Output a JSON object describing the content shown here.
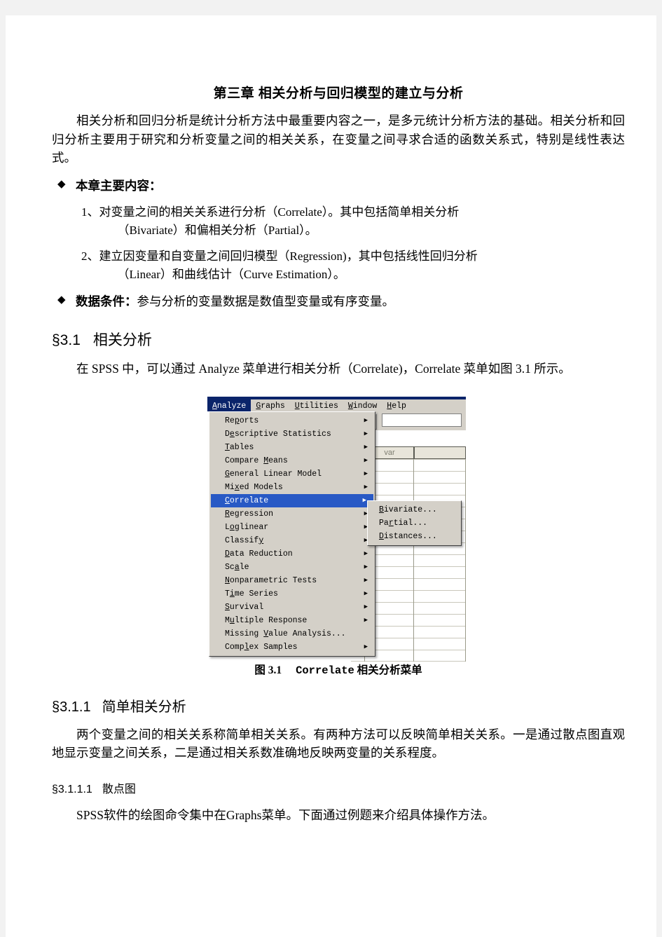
{
  "document": {
    "title": "第三章  相关分析与回归模型的建立与分析",
    "intro_paragraph": "相关分析和回归分析是统计分析方法中最重要内容之一，是多元统计分析方法的基础。相关分析和回归分析主要用于研究和分析变量之间的相关关系，在变量之间寻求合适的函数关系式，特别是线性表达式。",
    "bullets": {
      "marker": "◆",
      "main_content_label": "本章主要内容：",
      "items": [
        {
          "number": "1、",
          "line1": "对变量之间的相关关系进行分析（Correlate）。其中包括简单相关分析",
          "line2": "（Bivariate）和偏相关分析（Partial）。"
        },
        {
          "number": "2、",
          "line1": "建立因变量和自变量之间回归模型（Regression)，其中包括线性回归分析",
          "line2": "（Linear）和曲线估计（Curve Estimation）。"
        }
      ],
      "data_condition_label": "数据条件：",
      "data_condition_text": "参与分析的变量数据是数值型变量或有序变量。"
    },
    "sections": [
      {
        "number": "§3.1",
        "title": "相关分析",
        "paragraph": "在 SPSS 中，可以通过 Analyze 菜单进行相关分析（Correlate)，Correlate 菜单如图 3.1 所示。"
      },
      {
        "number": "§3.1.1",
        "title": "简单相关分析",
        "paragraph": "两个变量之间的相关关系称简单相关关系。有两种方法可以反映简单相关关系。一是通过散点图直观地显示变量之间关系，二是通过相关系数准确地反映两变量的关系程度。"
      },
      {
        "number": "§3.1.1.1",
        "title": "散点图",
        "paragraph": "SPSS软件的绘图命令集中在Graphs菜单。下面通过例题来介绍具体操作方法。"
      }
    ],
    "figure": {
      "caption_label": "图 3.1",
      "caption_name": "Correlate",
      "caption_tail": "相关分析菜单"
    }
  },
  "spss": {
    "menubar": [
      {
        "pre": "",
        "key": "A",
        "post": "nalyze",
        "active": true
      },
      {
        "pre": "",
        "key": "G",
        "post": "raphs",
        "active": false
      },
      {
        "pre": "",
        "key": "U",
        "post": "tilities",
        "active": false
      },
      {
        "pre": "",
        "key": "W",
        "post": "indow",
        "active": false
      },
      {
        "pre": "",
        "key": "H",
        "post": "elp",
        "active": false
      }
    ],
    "analyze_menu": [
      {
        "pre": "Re",
        "key": "p",
        "post": "orts",
        "arrow": "▶",
        "selected": false
      },
      {
        "pre": "D",
        "key": "e",
        "post": "scriptive Statistics",
        "arrow": "▶",
        "selected": false
      },
      {
        "pre": "",
        "key": "T",
        "post": "ables",
        "arrow": "▶",
        "selected": false
      },
      {
        "pre": "Compare ",
        "key": "M",
        "post": "eans",
        "arrow": "▶",
        "selected": false
      },
      {
        "pre": "",
        "key": "G",
        "post": "eneral Linear Model",
        "arrow": "▶",
        "selected": false
      },
      {
        "pre": "Mi",
        "key": "x",
        "post": "ed Models",
        "arrow": "▶",
        "selected": false
      },
      {
        "pre": "",
        "key": "C",
        "post": "orrelate",
        "arrow": "▶",
        "selected": true
      },
      {
        "pre": "",
        "key": "R",
        "post": "egression",
        "arrow": "▶",
        "selected": false
      },
      {
        "pre": "L",
        "key": "o",
        "post": "glinear",
        "arrow": "▶",
        "selected": false
      },
      {
        "pre": "Classif",
        "key": "y",
        "post": "",
        "arrow": "▶",
        "selected": false
      },
      {
        "pre": "",
        "key": "D",
        "post": "ata Reduction",
        "arrow": "▶",
        "selected": false
      },
      {
        "pre": "Sc",
        "key": "a",
        "post": "le",
        "arrow": "▶",
        "selected": false
      },
      {
        "pre": "",
        "key": "N",
        "post": "onparametric Tests",
        "arrow": "▶",
        "selected": false
      },
      {
        "pre": "T",
        "key": "i",
        "post": "me Series",
        "arrow": "▶",
        "selected": false
      },
      {
        "pre": "",
        "key": "S",
        "post": "urvival",
        "arrow": "▶",
        "selected": false
      },
      {
        "pre": "M",
        "key": "u",
        "post": "ltiple Response",
        "arrow": "▶",
        "selected": false
      },
      {
        "pre": "Missing ",
        "key": "V",
        "post": "alue Analysis...",
        "arrow": "",
        "selected": false
      },
      {
        "pre": "Comp",
        "key": "l",
        "post": "ex Samples",
        "arrow": "▶",
        "selected": false
      }
    ],
    "correlate_submenu": [
      {
        "pre": "",
        "key": "B",
        "post": "ivariate..."
      },
      {
        "pre": "Pa",
        "key": "r",
        "post": "tial..."
      },
      {
        "pre": "",
        "key": "D",
        "post": "istances..."
      }
    ],
    "grid": {
      "column_header_var": "var",
      "toolbar_icon": "chart-icon"
    },
    "colors": {
      "titlebar": "#0a246a",
      "menu_face": "#d4d0c8",
      "highlight": "#2859c5",
      "header_face": "#e8e5da"
    }
  }
}
